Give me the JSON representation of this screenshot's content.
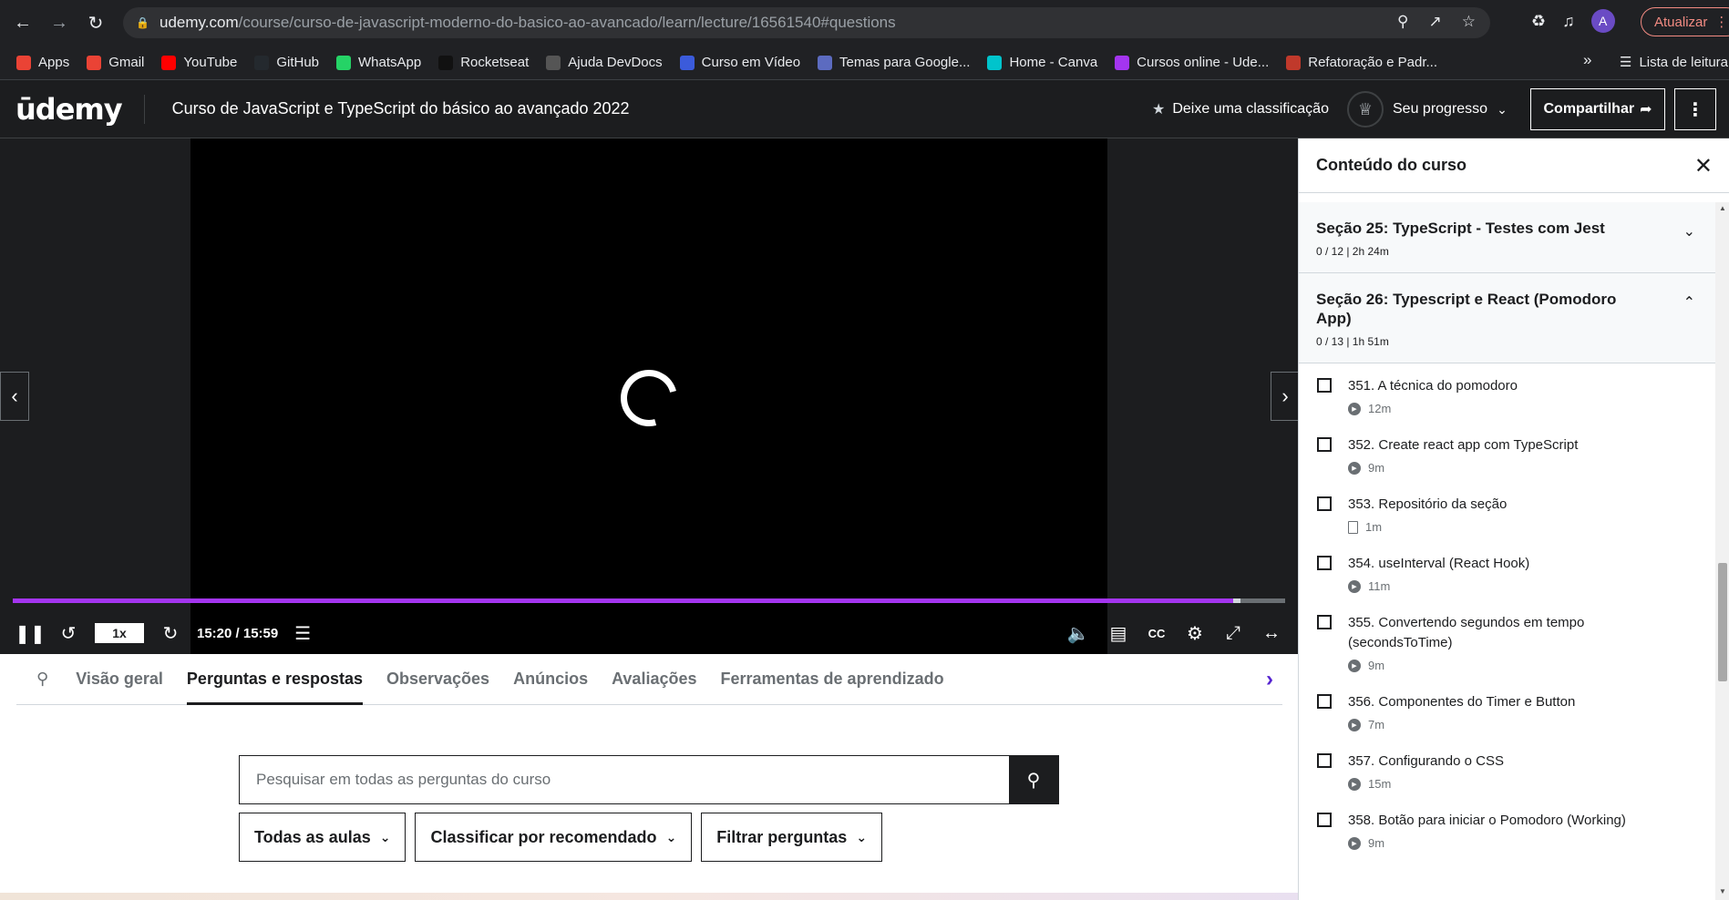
{
  "browser": {
    "url_host": "udemy.com",
    "url_path": "/course/curso-de-javascript-moderno-do-basico-ao-avancado/learn/lecture/16561540#questions",
    "profile_initial": "A",
    "update_label": "Atualizar",
    "bookmarks": [
      {
        "label": "Apps",
        "icon": "apps-grid-icon",
        "color": "#ea4335"
      },
      {
        "label": "Gmail",
        "icon": "gmail-icon",
        "color": "#ea4335"
      },
      {
        "label": "YouTube",
        "icon": "youtube-icon",
        "color": "#ff0000"
      },
      {
        "label": "GitHub",
        "icon": "github-icon",
        "color": "#24292e"
      },
      {
        "label": "WhatsApp",
        "icon": "whatsapp-icon",
        "color": "#25d366"
      },
      {
        "label": "Rocketseat",
        "icon": "rocketseat-icon",
        "color": "#111111"
      },
      {
        "label": "Ajuda DevDocs",
        "icon": "devdocs-icon",
        "color": "#555555"
      },
      {
        "label": "Curso em Vídeo",
        "icon": "cursoemvideo-icon",
        "color": "#3b5bdb"
      },
      {
        "label": "Temas para Google...",
        "icon": "themes-icon",
        "color": "#5c6bc0"
      },
      {
        "label": "Home - Canva",
        "icon": "canva-icon",
        "color": "#00c4cc"
      },
      {
        "label": "Cursos online - Ude...",
        "icon": "udemy-bookmark-icon",
        "color": "#a435f0"
      },
      {
        "label": "Refatoração e Padr...",
        "icon": "refactoring-icon",
        "color": "#c0392b"
      }
    ],
    "more_label": "»",
    "reading_list_label": "Lista de leitura"
  },
  "header": {
    "logo": "ūdemy",
    "course_title": "Curso de JavaScript e TypeScript do básico ao avançado 2022",
    "rating_label": "Deixe uma classificação",
    "progress_label": "Seu progresso",
    "share_label": "Compartilhar"
  },
  "player": {
    "playback_rate": "1x",
    "time": "15:20 / 15:59",
    "progress_fraction": 0.9593,
    "buffered_fraction": 0.965
  },
  "tabs": [
    {
      "label": "Visão geral",
      "active": false
    },
    {
      "label": "Perguntas e respostas",
      "active": true
    },
    {
      "label": "Observações",
      "active": false
    },
    {
      "label": "Anúncios",
      "active": false
    },
    {
      "label": "Avaliações",
      "active": false
    },
    {
      "label": "Ferramentas de aprendizado",
      "active": false
    }
  ],
  "qa": {
    "search_placeholder": "Pesquisar em todas as perguntas do curso",
    "filters": [
      "Todas as aulas",
      "Classificar por recomendado",
      "Filtrar perguntas"
    ]
  },
  "sidebar": {
    "title": "Conteúdo do curso",
    "sections": [
      {
        "title": "Seção 25: TypeScript - Testes com Jest",
        "meta": "0 / 12 | 2h 24m",
        "expanded": false
      },
      {
        "title": "Seção 26: Typescript e React (Pomodoro App)",
        "meta": "0 / 13 | 1h 51m",
        "expanded": true
      }
    ],
    "lessons": [
      {
        "title": "351. A técnica do pomodoro",
        "duration": "12m",
        "type": "video"
      },
      {
        "title": "352. Create react app com TypeScript",
        "duration": "9m",
        "type": "video"
      },
      {
        "title": "353. Repositório da seção",
        "duration": "1m",
        "type": "article"
      },
      {
        "title": "354. useInterval (React Hook)",
        "duration": "11m",
        "type": "video"
      },
      {
        "title": "355. Convertendo segundos em tempo (secondsToTime)",
        "duration": "9m",
        "type": "video"
      },
      {
        "title": "356. Componentes do Timer e Button",
        "duration": "7m",
        "type": "video"
      },
      {
        "title": "357. Configurando o CSS",
        "duration": "15m",
        "type": "video"
      },
      {
        "title": "358. Botão para iniciar o Pomodoro (Working)",
        "duration": "9m",
        "type": "video"
      }
    ]
  }
}
